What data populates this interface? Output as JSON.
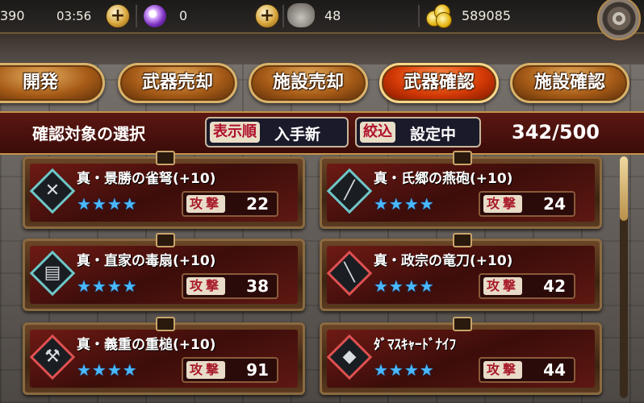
{
  "status": {
    "stamina": "390",
    "timer": "03:56",
    "orbs": "0",
    "bags": "48",
    "gold": "589085"
  },
  "tabs": [
    {
      "label": "開発"
    },
    {
      "label": "武器売却"
    },
    {
      "label": "施設売却"
    },
    {
      "label": "武器確認",
      "active": true
    },
    {
      "label": "施設確認"
    }
  ],
  "filter": {
    "title": "確認対象の選択",
    "sort_key": "表示順",
    "sort_value": "入手新",
    "filter_key": "絞込",
    "filter_value": "設定中",
    "count": "342/500"
  },
  "weapons": [
    {
      "name": "真・景勝の雀弩(+10)",
      "stars": "★★★★",
      "atk_label": "攻撃",
      "atk": "22",
      "icon": "crossbow-icon"
    },
    {
      "name": "真・氏郷の燕砲(+10)",
      "stars": "★★★★",
      "atk_label": "攻撃",
      "atk": "24",
      "icon": "rifle-icon"
    },
    {
      "name": "真・直家の毒扇(+10)",
      "stars": "★★★★",
      "atk_label": "攻撃",
      "atk": "38",
      "icon": "fan-icon"
    },
    {
      "name": "真・政宗の竜刀(+10)",
      "stars": "★★★★",
      "atk_label": "攻撃",
      "atk": "42",
      "icon": "katana-icon"
    },
    {
      "name": "真・義重の重槌(+10)",
      "stars": "★★★★",
      "atk_label": "攻撃",
      "atk": "91",
      "icon": "hammer-icon"
    },
    {
      "name": "ﾀﾞﾏｽｷｬｰﾄﾞﾅｲﾌ",
      "stars": "★★★★",
      "atk_label": "攻撃",
      "atk": "44",
      "icon": "kunai-icon"
    }
  ],
  "colors": {
    "accent": "#d43a06",
    "star": "#49b8ff",
    "panel": "#3b0c09"
  }
}
